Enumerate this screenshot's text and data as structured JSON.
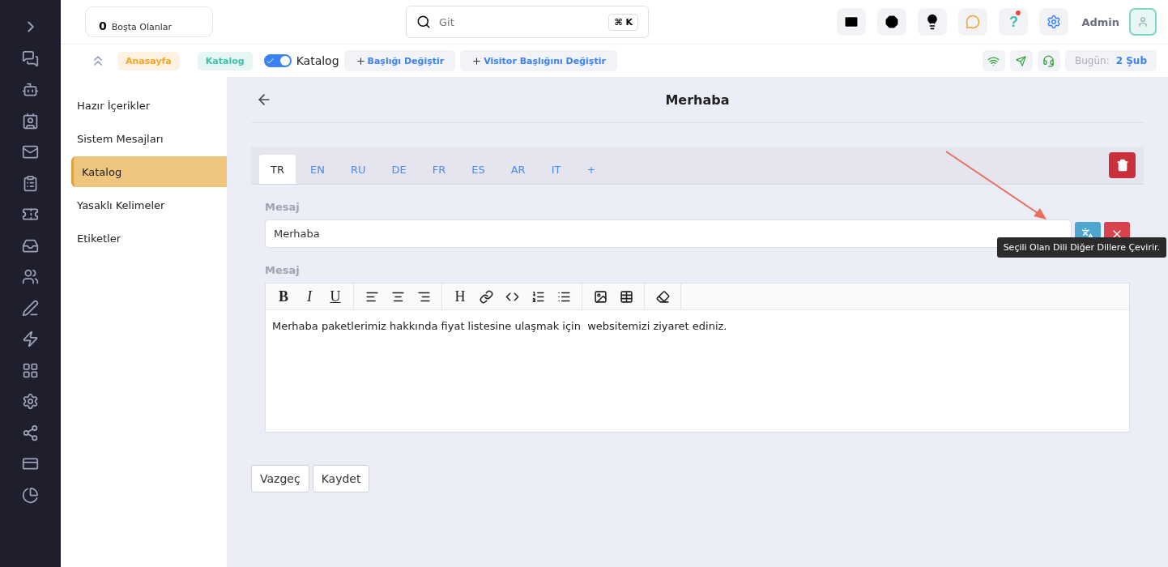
{
  "header": {
    "idle": {
      "count": "0",
      "label": "Boşta Olanlar"
    },
    "search": {
      "placeholder": "Git",
      "shortcut": "⌘ K"
    },
    "user": "Admin",
    "help": "?",
    "help_alert": true
  },
  "breadcrumb": {
    "items": [
      {
        "label": "Anasayfa",
        "color": "#f5a623"
      },
      {
        "label": "Katalog",
        "color": "#3cbfae"
      }
    ],
    "toggle": {
      "on": true,
      "label": "Katalog"
    },
    "actions": [
      "Başlığı Değiştir",
      "Visitor Başlığını Değiştir"
    ],
    "today_label": "Bugün:",
    "today_value": "2 Şub"
  },
  "menu": [
    {
      "label": "Hazır İçerikler",
      "selected": false
    },
    {
      "label": "Sistem Mesajları",
      "selected": false
    },
    {
      "label": "Katalog",
      "selected": true
    },
    {
      "label": "Yasaklı Kelimeler",
      "selected": false
    },
    {
      "label": "Etiketler",
      "selected": false
    }
  ],
  "page": {
    "title": "Merhaba"
  },
  "tabs": [
    {
      "label": "TR",
      "selected": true
    },
    {
      "label": "EN",
      "selected": false
    },
    {
      "label": "RU",
      "selected": false
    },
    {
      "label": "DE",
      "selected": false
    },
    {
      "label": "FR",
      "selected": false
    },
    {
      "label": "ES",
      "selected": false
    },
    {
      "label": "AR",
      "selected": false
    },
    {
      "label": "IT",
      "selected": false
    },
    {
      "label": "+",
      "selected": false
    }
  ],
  "name_field": {
    "label": "Mesaj",
    "value": "Merhaba"
  },
  "tooltip": "Seçili Olan Dili Diğer Dillere Çevirir.",
  "editor": {
    "label": "Mesaj",
    "toolbar": [
      [
        {
          "kind": "text",
          "label": "B"
        },
        {
          "kind": "text",
          "label": "I"
        },
        {
          "kind": "text",
          "label": "U"
        }
      ],
      [
        {
          "kind": "align-left"
        },
        {
          "kind": "align-center"
        },
        {
          "kind": "align-right"
        }
      ],
      [
        {
          "kind": "text",
          "label": "H"
        },
        {
          "kind": "link"
        },
        {
          "kind": "code"
        },
        {
          "kind": "ordered-list"
        },
        {
          "kind": "bullet-list"
        }
      ],
      [
        {
          "kind": "image"
        },
        {
          "kind": "table"
        }
      ],
      [
        {
          "kind": "eraser"
        }
      ]
    ],
    "content": "Merhaba paketlerimiz hakkında fiyat listesine ulaşmak için  websitemizi ziyaret ediniz."
  },
  "buttons": [
    "Vazgeç",
    "Kaydet"
  ]
}
